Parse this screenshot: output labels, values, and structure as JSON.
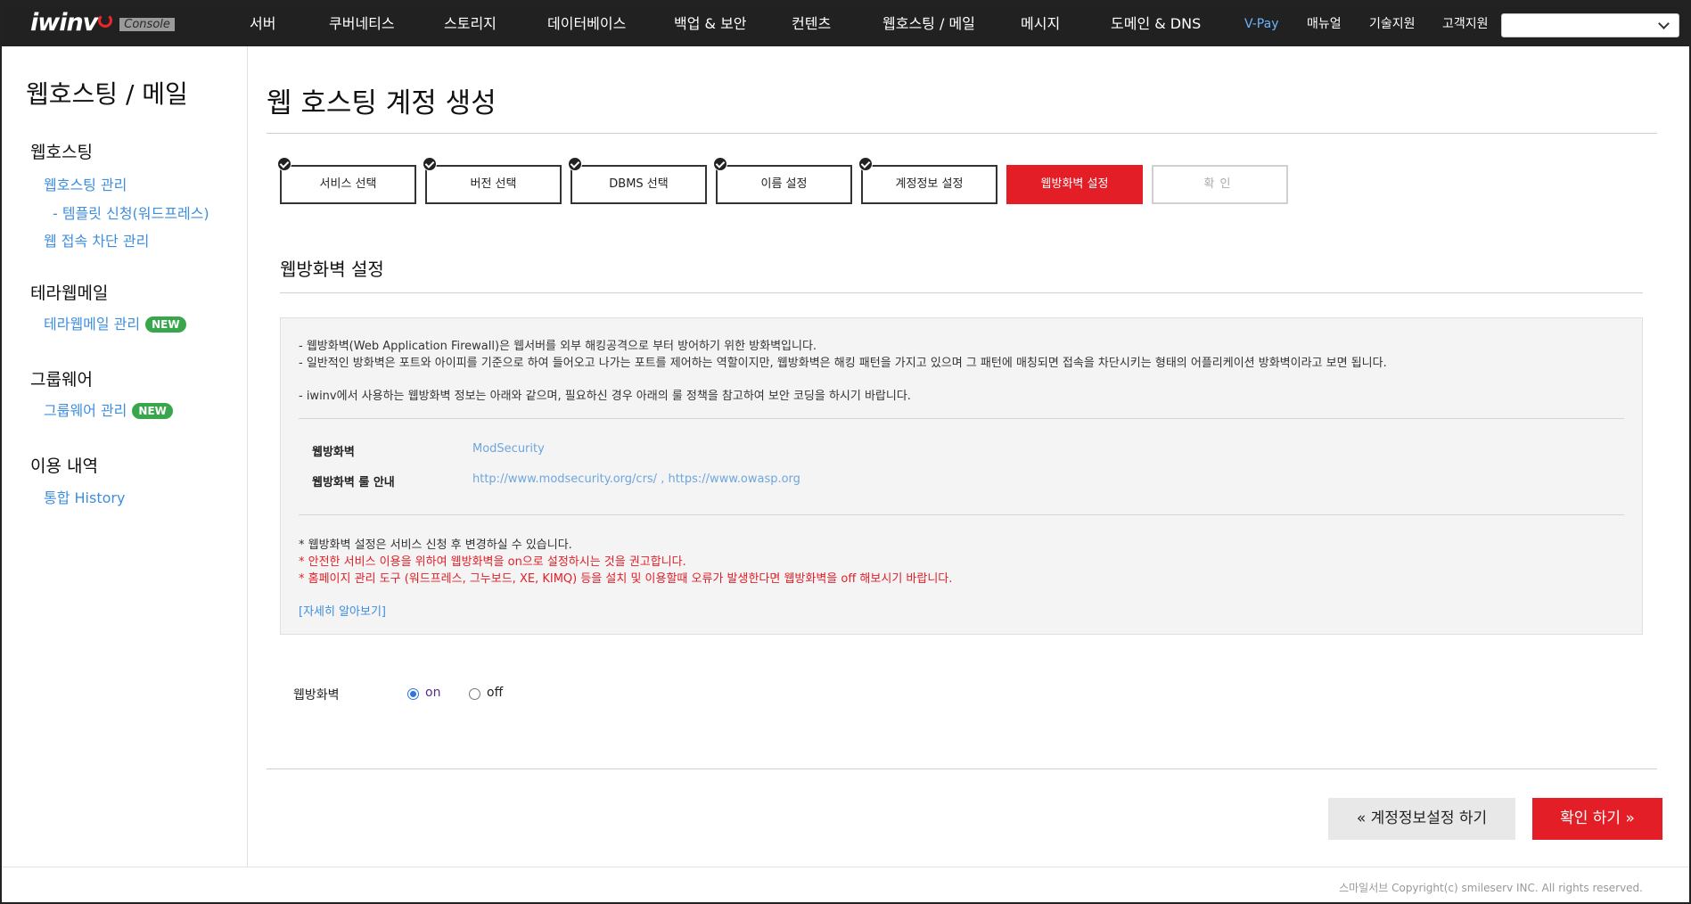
{
  "app": {
    "logo_text": "iwinv",
    "console_label": "Console"
  },
  "nav": {
    "items": [
      "서버",
      "쿠버네티스",
      "스토리지",
      "데이터베이스",
      "백업 & 보안",
      "컨텐츠",
      "웹호스팅 / 메일",
      "메시지",
      "도메인 & DNS"
    ],
    "vpay": "V-Pay",
    "right_items": [
      "매뉴얼",
      "기술지원",
      "고객지원"
    ],
    "select_value": ""
  },
  "sidebar": {
    "title": "웹호스팅 / 메일",
    "groups": [
      {
        "heading": "웹호스팅",
        "links": [
          "웹호스팅 관리",
          "- 템플릿 신청(워드프레스)",
          "웹 접속 차단 관리"
        ]
      },
      {
        "heading": "테라웹메일",
        "links": [
          "테라웹메일 관리"
        ],
        "badge": "NEW"
      },
      {
        "heading": "그룹웨어",
        "links": [
          "그룹웨어 관리"
        ],
        "badge": "NEW"
      },
      {
        "heading": "이용 내역",
        "links": [
          "통합 History"
        ]
      }
    ]
  },
  "main": {
    "title": "웹 호스팅 계정 생성",
    "steps": [
      {
        "label": "서비스 선택",
        "state": "done"
      },
      {
        "label": "버전 선택",
        "state": "done"
      },
      {
        "label": "DBMS 선택",
        "state": "done"
      },
      {
        "label": "이름 설정",
        "state": "done"
      },
      {
        "label": "계정정보 설정",
        "state": "done"
      },
      {
        "label": "웹방화벽 설정",
        "state": "active"
      },
      {
        "label": "확인",
        "state": "pending"
      }
    ],
    "section_title": "웹방화벽 설정",
    "info": {
      "line1": "- 웹방화벽(Web Application Firewall)은 웹서버를 외부 해킹공격으로 부터 방어하기 위한 방화벽입니다.",
      "line2": "- 일반적인 방화벽은 포트와 아이피를 기준으로 하여 들어오고 나가는 포트를 제어하는 역할이지만, 웹방화벽은 해킹 패턴을 가지고 있으며 그 패턴에 매칭되면 접속을 차단시키는 형태의 어플리케이션 방화벽이라고 보면 됩니다.",
      "line3": "- iwinv에서 사용하는 웹방화벽 정보는 아래와 같으며, 필요하신 경우 아래의 룰 정책을 참고하여 보안 코딩을 하시기 바랍니다.",
      "kv": [
        {
          "label": "웹방화벽",
          "value": "ModSecurity"
        },
        {
          "label": "웹방화벽 룰 안내",
          "value": "http://www.modsecurity.org/crs/ , https://www.owasp.org"
        }
      ],
      "note1": "* 웹방화벽 설정은 서비스 신청 후 변경하실 수 있습니다.",
      "note2": "* 안전한 서비스 이용을 위하여 웹방화벽을 on으로 설정하시는 것을 권고합니다.",
      "note3": "* 홈페이지 관리 도구 (워드프레스, 그누보드, XE, KIMQ) 등을 설치 및 이용할때 오류가 발생한다면 웹방화벽을 off 해보시기 바랍니다.",
      "more_link": "[자세히 알아보기]"
    },
    "firewall": {
      "label": "웹방화벽",
      "options": [
        "on",
        "off"
      ],
      "selected": "on"
    },
    "buttons": {
      "prev": "« 계정정보설정 하기",
      "confirm": "확인 하기 »"
    }
  },
  "footer": {
    "copyright": "스마일서브 Copyright(c) smileserv INC. All rights reserved."
  }
}
